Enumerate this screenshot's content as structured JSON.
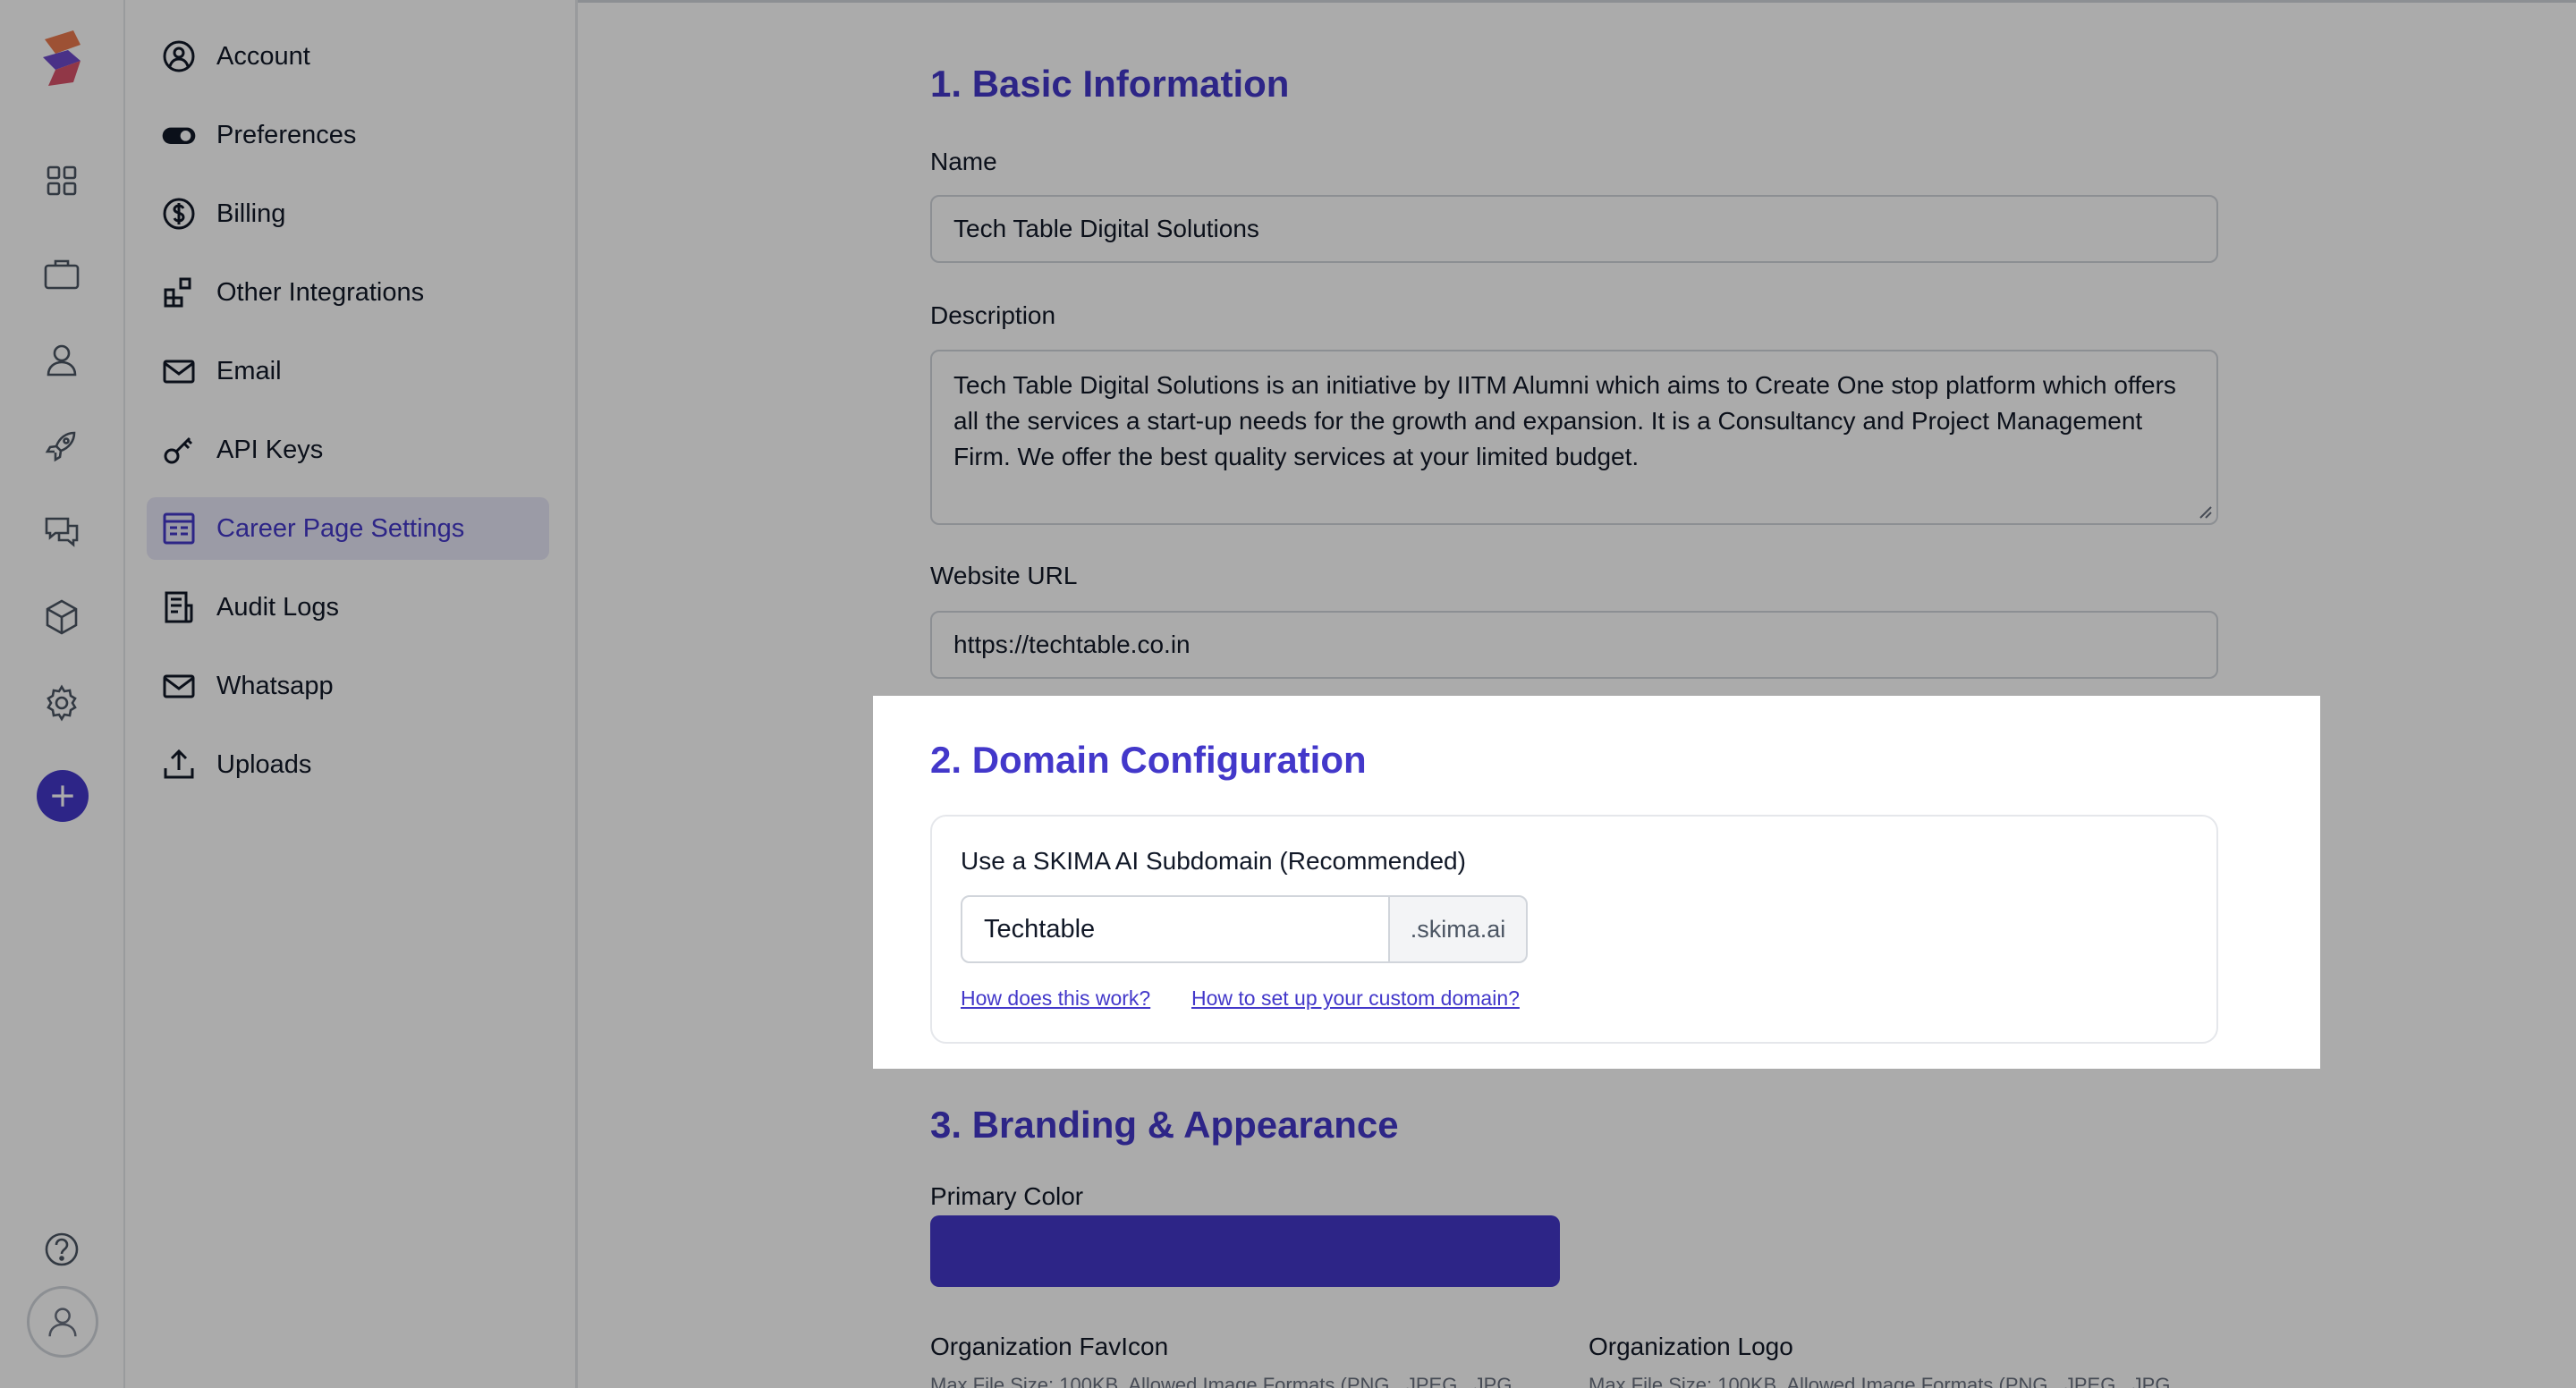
{
  "colors": {
    "accent": "#4338ca",
    "primary_color_swatch": "#4338ca",
    "active_menu_bg": "#e8e7f8"
  },
  "rail": {
    "icons": [
      "dashboard-icon",
      "briefcase-icon",
      "user-icon",
      "rocket-icon",
      "chat-icon",
      "cube-icon",
      "settings-icon",
      "add-icon",
      "help-icon",
      "profile-avatar-icon"
    ]
  },
  "menu": {
    "items": [
      {
        "label": "Account",
        "icon": "account-circle-icon"
      },
      {
        "label": "Preferences",
        "icon": "toggle-icon"
      },
      {
        "label": "Billing",
        "icon": "dollar-icon"
      },
      {
        "label": "Other Integrations",
        "icon": "integrations-icon"
      },
      {
        "label": "Email",
        "icon": "mail-icon"
      },
      {
        "label": "API Keys",
        "icon": "key-icon"
      },
      {
        "label": "Career Page Settings",
        "icon": "career-page-icon",
        "active": true
      },
      {
        "label": "Audit Logs",
        "icon": "document-icon"
      },
      {
        "label": "Whatsapp",
        "icon": "mail-icon"
      },
      {
        "label": "Uploads",
        "icon": "upload-icon"
      }
    ]
  },
  "basic": {
    "title": "1. Basic Information",
    "name_label": "Name",
    "name_value": "Tech Table Digital Solutions",
    "description_label": "Description",
    "description_value": "Tech Table Digital Solutions is an initiative by IITM Alumni which aims to Create One stop platform which offers all the services a start-up needs for the growth and expansion. It is a Consultancy and Project Management Firm. We offer the best quality services at your limited budget.",
    "website_label": "Website URL",
    "website_value": "https://techtable.co.in"
  },
  "domain": {
    "title": "2. Domain Configuration",
    "option_label": "Use a SKIMA AI Subdomain (Recommended)",
    "subdomain_value": "Techtable",
    "suffix": ".skima.ai",
    "link_how": "How does this work?",
    "link_custom": "How to set up your custom domain?"
  },
  "branding": {
    "title": "3. Branding & Appearance",
    "primary_color_label": "Primary Color",
    "favicon_label": "Organization FavIcon",
    "favicon_hint": "Max File Size: 100KB, Allowed Image Formats (PNG , JPEG , JPG",
    "logo_label": "Organization Logo",
    "logo_hint": "Max File Size: 100KB, Allowed Image Formats (PNG , JPEG , JPG"
  }
}
